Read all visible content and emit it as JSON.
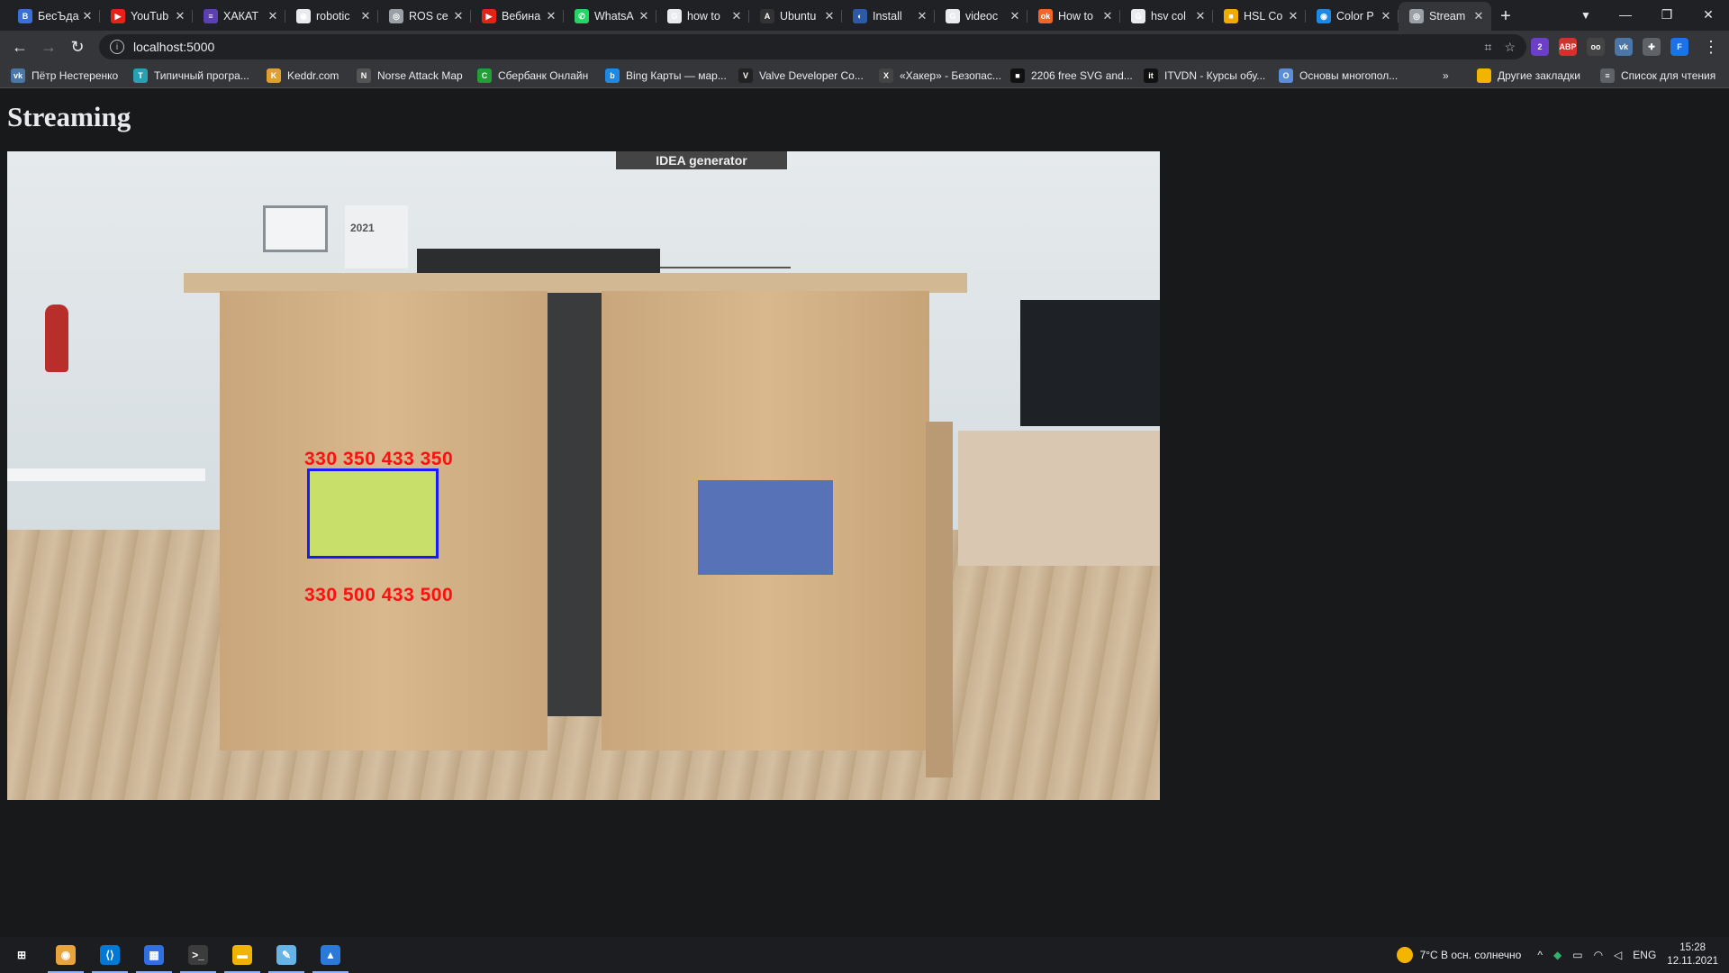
{
  "browser": {
    "tabs": [
      {
        "title": "БесЪда",
        "favicon_color": "#3b6fd8",
        "favicon": "B"
      },
      {
        "title": "YouTub",
        "favicon_color": "#e62117",
        "favicon": "▶"
      },
      {
        "title": "ХАКАТ",
        "favicon_color": "#5b3fb3",
        "favicon": "≡"
      },
      {
        "title": "robotic",
        "favicon_color": "#e8eaed",
        "favicon": "◉"
      },
      {
        "title": "ROS ce",
        "favicon_color": "#9aa0a6",
        "favicon": "◎"
      },
      {
        "title": "Вебина",
        "favicon_color": "#e62117",
        "favicon": "▶"
      },
      {
        "title": "WhatsA",
        "favicon_color": "#25d366",
        "favicon": "✆"
      },
      {
        "title": "how to",
        "favicon_color": "#e8eaed",
        "favicon": "G"
      },
      {
        "title": "Ubuntu",
        "favicon_color": "#333333",
        "favicon": "A"
      },
      {
        "title": "Install",
        "favicon_color": "#2d5aa8",
        "favicon": "◐"
      },
      {
        "title": "videoc",
        "favicon_color": "#e8eaed",
        "favicon": "G"
      },
      {
        "title": "How to",
        "favicon_color": "#f26522",
        "favicon": "ok"
      },
      {
        "title": "hsv col",
        "favicon_color": "#e8eaed",
        "favicon": "G"
      },
      {
        "title": "HSL Co",
        "favicon_color": "#f2a900",
        "favicon": "■"
      },
      {
        "title": "Color P",
        "favicon_color": "#1e88e5",
        "favicon": "◉"
      },
      {
        "title": "Stream",
        "favicon_color": "#9aa0a6",
        "favicon": "◎",
        "active": true
      }
    ],
    "url": "localhost:5000",
    "bookmarks": [
      {
        "label": "Пётр Нестеренко",
        "icon_color": "#4a76a8",
        "icon": "vk"
      },
      {
        "label": "Типичный програ...",
        "icon_color": "#29a0b1",
        "icon": "T"
      },
      {
        "label": "Keddr.com",
        "icon_color": "#e0a030",
        "icon": "K"
      },
      {
        "label": "Norse Attack Map",
        "icon_color": "#555555",
        "icon": "N"
      },
      {
        "label": "Сбербанк Онлайн",
        "icon_color": "#21a038",
        "icon": "С"
      },
      {
        "label": "Bing Карты — мар...",
        "icon_color": "#1e88e5",
        "icon": "b"
      },
      {
        "label": "Valve Developer Co...",
        "icon_color": "#222222",
        "icon": "V"
      },
      {
        "label": "«Хакер» - Безопас...",
        "icon_color": "#444444",
        "icon": "Х"
      },
      {
        "label": "2206 free SVG and...",
        "icon_color": "#111111",
        "icon": "■"
      },
      {
        "label": "ITVDN - Курсы обу...",
        "icon_color": "#111111",
        "icon": "it"
      },
      {
        "label": "Основы многопол...",
        "icon_color": "#5a8ed8",
        "icon": "О"
      }
    ],
    "bookmarks_more": "»",
    "other_bookmarks": "Другие закладки",
    "reading_list": "Список для чтения",
    "extensions": [
      {
        "name": "ext-purple",
        "color": "#6b3fc8",
        "label": "2"
      },
      {
        "name": "adblock",
        "color": "#d6302c",
        "label": "ABP"
      },
      {
        "name": "ext-glasses",
        "color": "#444444",
        "label": "oo"
      },
      {
        "name": "vk",
        "color": "#4a76a8",
        "label": "vk"
      },
      {
        "name": "puzzle",
        "color": "#5f6368",
        "label": "✚"
      },
      {
        "name": "profile",
        "color": "#1a73e8",
        "label": "F"
      }
    ]
  },
  "page": {
    "title": "Streaming",
    "detection": {
      "top_label": "330  350  433  350",
      "bottom_label": "330  500  433  500",
      "box_color": "#1a1aff",
      "label_color": "#ff1010"
    },
    "scene_text": {
      "wall_art_label": "IDEA  generator",
      "calendar_year": "2021"
    }
  },
  "taskbar": {
    "apps": [
      {
        "name": "windows-start",
        "color": "#ffffff",
        "glyph": "⊞"
      },
      {
        "name": "chrome",
        "color": "#e8a33a",
        "glyph": "◉",
        "active": true
      },
      {
        "name": "vscode",
        "color": "#0078d4",
        "glyph": "⟨⟩",
        "active": true
      },
      {
        "name": "app-grid",
        "color": "#2f6fdf",
        "glyph": "▦",
        "active": true
      },
      {
        "name": "terminal",
        "color": "#3c3c3c",
        "glyph": ">_",
        "active": true
      },
      {
        "name": "file-explorer",
        "color": "#f0b400",
        "glyph": "▬",
        "active": true
      },
      {
        "name": "paint",
        "color": "#66b3e8",
        "glyph": "✎",
        "active": true
      },
      {
        "name": "photos",
        "color": "#2b79d8",
        "glyph": "▲",
        "active": true
      }
    ],
    "weather": "7°C  В осн. солнечно",
    "language": "ENG",
    "time": "15:28",
    "date": "12.11.2021"
  }
}
